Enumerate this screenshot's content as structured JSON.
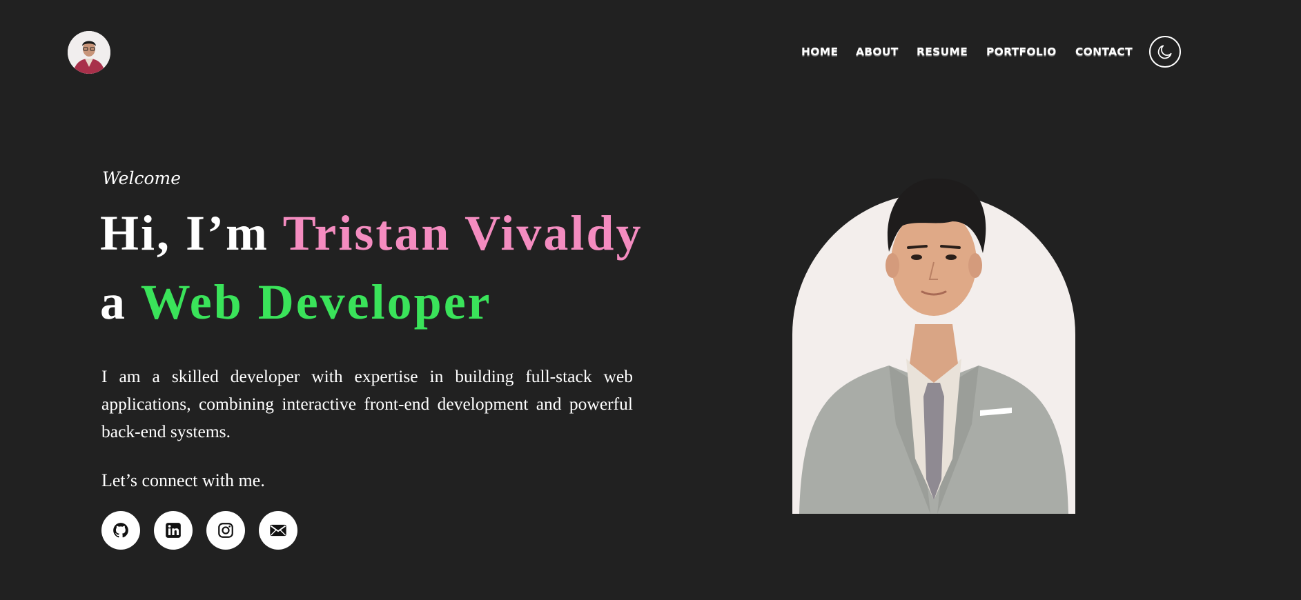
{
  "header": {
    "nav": [
      {
        "label": "HOME"
      },
      {
        "label": "ABOUT"
      },
      {
        "label": "RESUME"
      },
      {
        "label": "PORTFOLIO"
      },
      {
        "label": "CONTACT"
      }
    ],
    "theme_toggle_icon": "moon-icon"
  },
  "hero": {
    "welcome": "Welcome",
    "line1_prefix": "Hi, I’m ",
    "name": "Tristan Vivaldy",
    "line2_prefix": "a ",
    "role": "Web Developer",
    "intro": "I am a skilled developer with expertise in building full-stack web applications, combining interactive front-end development and powerful back-end systems.",
    "connect": "Let’s connect with me.",
    "socials": [
      {
        "icon": "github-icon"
      },
      {
        "icon": "linkedin-icon"
      },
      {
        "icon": "instagram-icon"
      },
      {
        "icon": "email-icon"
      }
    ]
  },
  "colors": {
    "background": "#212121",
    "name_accent": "#f48cc0",
    "role_accent": "#3ae35a",
    "text": "#ffffff"
  }
}
